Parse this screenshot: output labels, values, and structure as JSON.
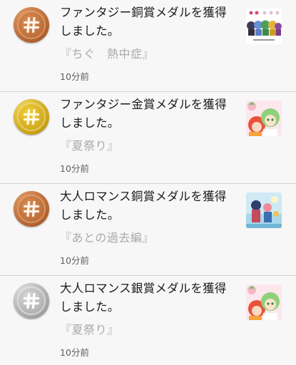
{
  "notifications": [
    {
      "medal": "bronze",
      "title": "ファンタジー銅賞メダルを獲得しました。",
      "work": "『ちぐ　熱中症』",
      "time": "10分前",
      "thumb_icon": "manga-group-thumbnail-icon"
    },
    {
      "medal": "gold",
      "title": "ファンタジー金賞メダルを獲得しました。",
      "work": "『夏祭り』",
      "time": "10分前",
      "thumb_icon": "manga-characters-thumbnail-icon"
    },
    {
      "medal": "bronze",
      "title": "大人ロマンス銅賞メダルを獲得しました。",
      "work": "『あとの過去編』",
      "time": "10分前",
      "thumb_icon": "manga-scene-thumbnail-icon"
    },
    {
      "medal": "silver",
      "title": "大人ロマンス銀賞メダルを獲得しました。",
      "work": "『夏祭り』",
      "time": "10分前",
      "thumb_icon": "manga-characters-thumbnail-icon"
    }
  ]
}
